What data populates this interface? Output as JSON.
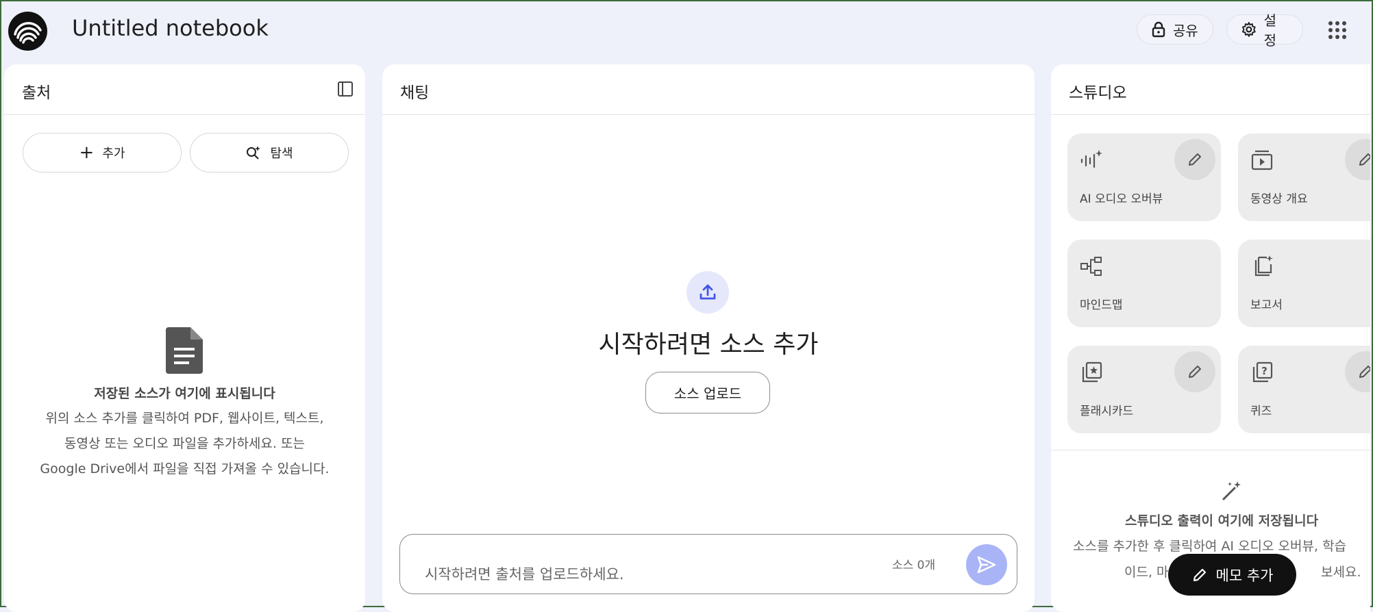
{
  "header": {
    "title": "Untitled notebook",
    "share_label": "공유",
    "settings_label": "설정"
  },
  "sources": {
    "title": "출처",
    "add_label": "추가",
    "explore_label": "탐색",
    "empty_title": "저장된 소스가 여기에 표시됩니다",
    "empty_desc_1": "위의 소스 추가를 클릭하여 PDF, 웹사이트, 텍스트,",
    "empty_desc_2": "동영상 또는 오디오 파일을 추가하세요. 또는",
    "empty_desc_3": "Google Drive에서 파일을 직접 가져올 수 있습니다."
  },
  "chat": {
    "title": "채팅",
    "empty_heading": "시작하려면 소스 추가",
    "upload_label": "소스 업로드",
    "input_placeholder": "시작하려면 출처를 업로드하세요.",
    "source_count": "소스 0개"
  },
  "studio": {
    "title": "스튜디오",
    "tiles": [
      {
        "label": "AI 오디오 오버뷰",
        "icon": "audio-sparkle-icon",
        "editable": true
      },
      {
        "label": "동영상 개요",
        "icon": "video-overview-icon",
        "editable": true
      },
      {
        "label": "마인드맵",
        "icon": "mindmap-icon",
        "editable": false
      },
      {
        "label": "보고서",
        "icon": "report-icon",
        "editable": false
      },
      {
        "label": "플래시카드",
        "icon": "flashcard-icon",
        "editable": true
      },
      {
        "label": "퀴즈",
        "icon": "quiz-icon",
        "editable": true
      }
    ],
    "empty_title": "스튜디오 출력이 여기에 저장됩니다",
    "empty_desc_1": "소스를 추가한 후 클릭하여 AI 오디오 오버뷰, 학습",
    "empty_desc_2": "이드, 마",
    "empty_desc_3": "보세요.",
    "add_memo_label": "메모 추가"
  },
  "colors": {
    "background": "#eef0fa",
    "accent": "#4355e6",
    "send_button": "#a9b4f7"
  }
}
